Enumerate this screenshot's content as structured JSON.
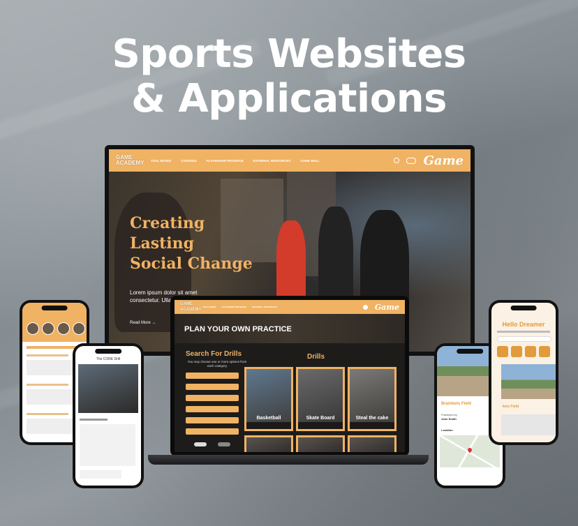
{
  "hero": {
    "line1": "Sports Websites",
    "line2": "& Applications"
  },
  "colors": {
    "accent": "#f0b263",
    "accent_dark": "#e39a3a",
    "bg": "#8c9499"
  },
  "monitor": {
    "logo": "GAME ACADEMY",
    "nav": [
      "TOOL BOXES",
      "COURSES",
      "PLAYMAKER PROGRAM",
      "EXTERNAL RESOURCES",
      "GAME WALL"
    ],
    "nav_game": "Game",
    "headline": [
      "Creating",
      "Lasting",
      "Social Change"
    ],
    "lorem": "Lorem ipsum dolor sit amet consectetur. Ullamcorper urna nibh.",
    "read_more": "Read More"
  },
  "laptop": {
    "logo": "GAME ACADEMY",
    "nav_game": "Game",
    "banner_title": "PLAN YOUR OWN PRACTICE",
    "search_title": "Search For Drills",
    "search_sub": "You may choose one or more options from each category",
    "drills_title": "Drills",
    "cards": [
      "Basketball",
      "Skate Board",
      "Steal the cake"
    ]
  },
  "phones": {
    "detail_title": "The CORE Drill",
    "field_title": "Brainkets Field",
    "published_by": "Published by",
    "author": "John Smith",
    "location": "Location",
    "hello": "Hello Dreamer",
    "field_short": "kets Field"
  }
}
